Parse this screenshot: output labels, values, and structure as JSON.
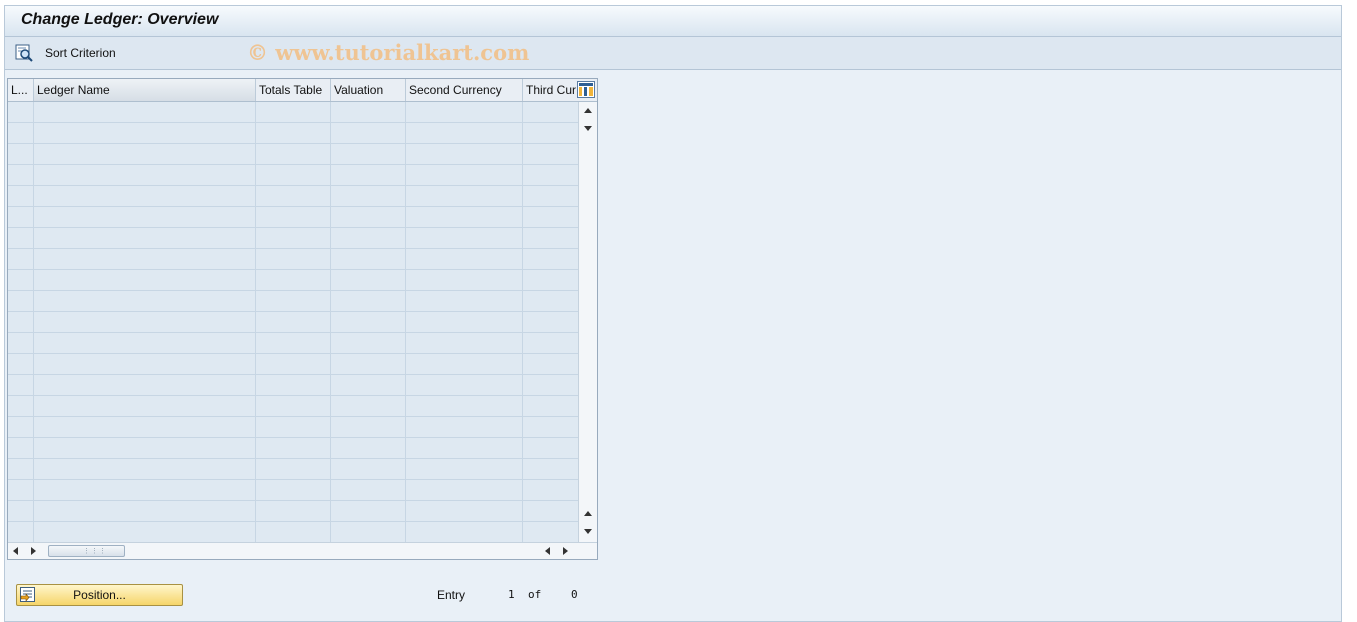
{
  "window": {
    "title": "Change Ledger: Overview"
  },
  "toolbar": {
    "sort_label": "Sort Criterion",
    "watermark": "© www.tutorialkart.com"
  },
  "table": {
    "columns": [
      {
        "label": "L..."
      },
      {
        "label": "Ledger Name"
      },
      {
        "label": "Totals Table"
      },
      {
        "label": "Valuation"
      },
      {
        "label": "Second Currency"
      },
      {
        "label": "Third Cur"
      }
    ],
    "rows": []
  },
  "footer": {
    "position_label": "Position...",
    "entry_label": "Entry",
    "entry_current": "1",
    "entry_of": "of",
    "entry_total": "0"
  },
  "colors": {
    "background": "#e9f0f7",
    "row": "#dfe9f2",
    "button_yellow": "#f6d56a",
    "watermark": "#efc493"
  },
  "icons": {
    "sort": "sort-criterion-icon",
    "column_settings": "table-settings-icon",
    "position": "position-icon"
  }
}
